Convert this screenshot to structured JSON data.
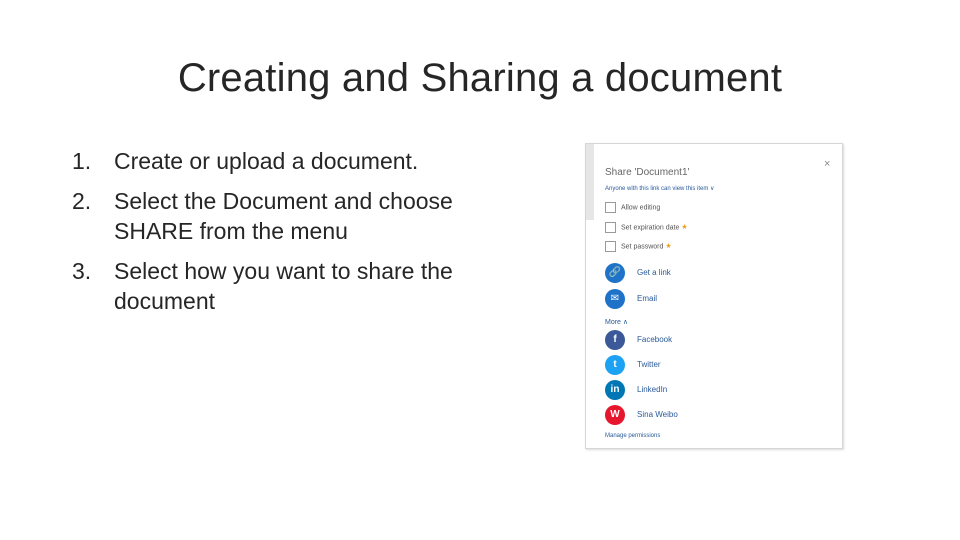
{
  "slide": {
    "title": "Creating and Sharing a document",
    "steps": [
      {
        "num": "1.",
        "text": "Create or upload a document."
      },
      {
        "num": "2.",
        "text": "Select the Document and choose SHARE from the menu"
      },
      {
        "num": "3.",
        "text": "Select how you want to share the document"
      }
    ]
  },
  "dialog": {
    "title": "Share 'Document1'",
    "close_icon": "×",
    "scope": "Anyone with this link can view this item ∨",
    "options": [
      {
        "label": "Allow editing",
        "premium": false
      },
      {
        "label": "Set expiration date",
        "premium": true
      },
      {
        "label": "Set password",
        "premium": true
      }
    ],
    "premium_icon": "★",
    "share_methods": [
      {
        "label": "Get a link",
        "icon": "link-icon",
        "glyph": "🔗",
        "color": "#1e73c8"
      },
      {
        "label": "Email",
        "icon": "email-icon",
        "glyph": "✉",
        "color": "#1e73c8"
      }
    ],
    "more_label": "More ∧",
    "social": [
      {
        "label": "Facebook",
        "icon": "facebook-icon",
        "glyph": "f",
        "color": "#3b5998"
      },
      {
        "label": "Twitter",
        "icon": "twitter-icon",
        "glyph": "t",
        "color": "#1da1f2"
      },
      {
        "label": "LinkedIn",
        "icon": "linkedin-icon",
        "glyph": "in",
        "color": "#0077b5"
      },
      {
        "label": "Sina Weibo",
        "icon": "weibo-icon",
        "glyph": "W",
        "color": "#e6162d"
      }
    ],
    "manage_label": "Manage permissions"
  }
}
